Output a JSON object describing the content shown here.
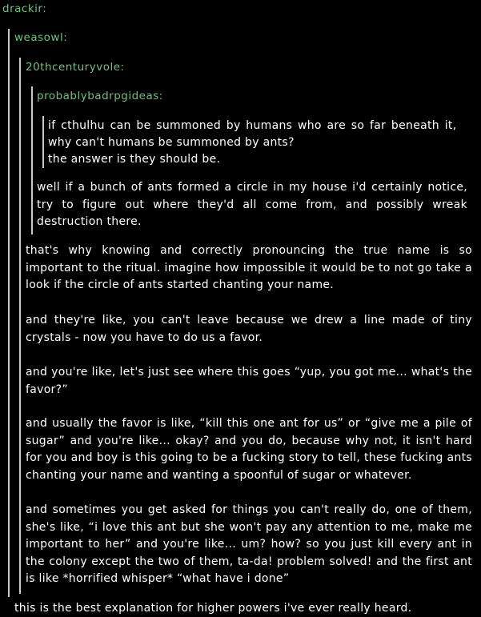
{
  "thread": {
    "users": {
      "drackir": "drackir:",
      "weasowl": "weasowl:",
      "vole": "20thcenturyvole:",
      "probably": "probablybadrpgideas:"
    },
    "original_post": [
      "if cthulhu can be summoned by humans who are so far beneath it,",
      "why can't humans be summoned by ants?",
      "the answer is they should be."
    ],
    "vole_reply": "well if a bunch of ants formed a circle in my house i'd certainly notice, try to figure out where they'd all come from, and possibly wreak destruction there.",
    "weasowl_reply": [
      "that's why knowing and correctly pronouncing the true name is so important to the ritual. imagine how impossible it would be to not go take a look if the circle of ants started chanting your name.",
      "and they're like, you can't leave because we drew a line made of tiny crystals - now you have to do us a favor.",
      "and you're like, let's just see where this goes “yup, you got me... what's the favor?”",
      "and usually the favor is like, “kill this one ant for us” or “give me a pile of sugar” and you're like... okay? and you do, because why not, it isn't hard for you and boy is this going to be a fucking story to tell, these fucking ants chanting your name and wanting a spoonful of sugar or whatever.",
      "and sometimes you get asked for things you can't really do, one of them, she's like, “i love this ant but she won't pay any attention to me, make me important to her” and you're like... um? how? so you just kill every ant in the colony except the two of them, ta-da! problem solved! and the first ant is like *horrified whisper* “what have i done”"
    ],
    "drackir_reply": "this is the best explanation for higher powers i've ever really heard."
  }
}
